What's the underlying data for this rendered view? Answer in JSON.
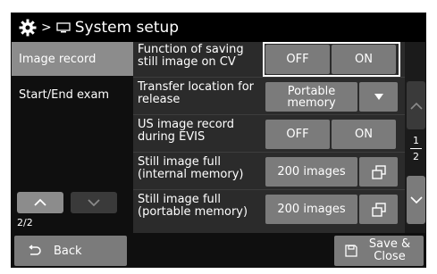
{
  "header": {
    "separator": ">",
    "title": "System setup"
  },
  "sidebar": {
    "items": [
      {
        "label": "Image record",
        "active": true
      },
      {
        "label": "Start/End exam",
        "active": false
      }
    ],
    "page": "2/2"
  },
  "settings": {
    "rows": [
      {
        "label": "Function of saving still image on CV",
        "options": [
          "OFF",
          "ON"
        ],
        "selected": "ON"
      },
      {
        "label": "Transfer location for release",
        "value": "Portable memory"
      },
      {
        "label": "US image record during EVIS",
        "options": [
          "OFF",
          "ON"
        ],
        "selected": "ON"
      },
      {
        "label": "Still image full (internal memory)",
        "value": "200 images"
      },
      {
        "label": "Still image full (portable memory)",
        "value": "200 images"
      }
    ]
  },
  "scroll": {
    "current_page": "1",
    "total_pages": "2"
  },
  "footer": {
    "back_label": "Back",
    "save_close_label": "Save & Close"
  },
  "colors": {
    "background": "#2b2b2b",
    "title_bar": "#000000",
    "selected_item": "#8c8c8c",
    "button": "#7b7b7b",
    "focus_border": "#ffffff"
  },
  "icons": {
    "title": "gear-icon",
    "location": "monitor-icon",
    "dropdown": "triangle-down-icon",
    "list": "overlap-windows-icon",
    "back": "return-arrow-icon",
    "save": "floppy-disk-icon"
  }
}
